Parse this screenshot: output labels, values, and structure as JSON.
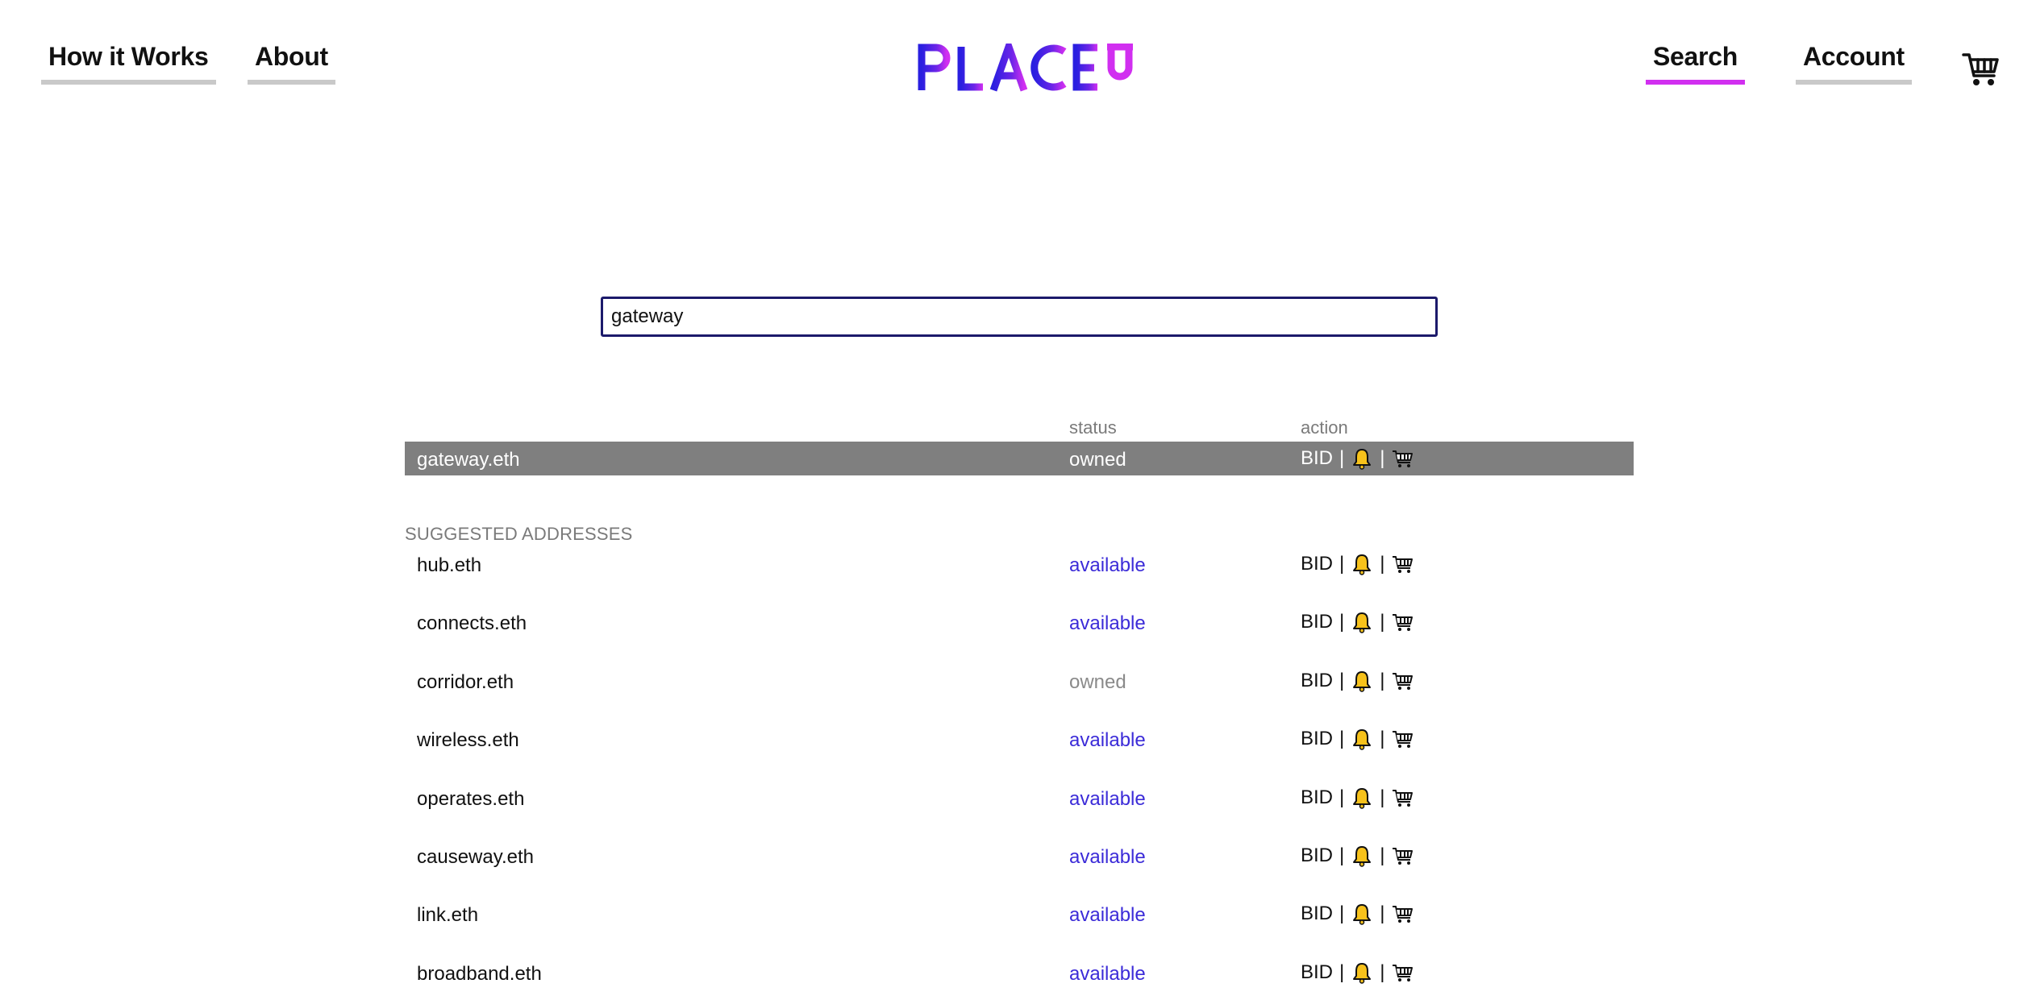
{
  "nav": {
    "how_it_works": "How it Works",
    "about": "About",
    "search": "Search",
    "account": "Account"
  },
  "brand": {
    "logo_text": "PLACEU",
    "colors": {
      "primary": "#2a1fe0",
      "accent": "#d12ff0"
    }
  },
  "search": {
    "value": "gateway"
  },
  "results": {
    "column_status": "status",
    "column_action": "action",
    "main": {
      "name": "gateway.eth",
      "status": "owned",
      "bid": "BID",
      "sep": "|"
    }
  },
  "suggested": {
    "label": "SUGGESTED ADDRESSES",
    "items": [
      {
        "name": "hub.eth",
        "status": "available",
        "bid": "BID",
        "sep": "|"
      },
      {
        "name": "connects.eth",
        "status": "available",
        "bid": "BID",
        "sep": "|"
      },
      {
        "name": "corridor.eth",
        "status": "owned",
        "bid": "BID",
        "sep": "|"
      },
      {
        "name": "wireless.eth",
        "status": "available",
        "bid": "BID",
        "sep": "|"
      },
      {
        "name": "operates.eth",
        "status": "available",
        "bid": "BID",
        "sep": "|"
      },
      {
        "name": "causeway.eth",
        "status": "available",
        "bid": "BID",
        "sep": "|"
      },
      {
        "name": "link.eth",
        "status": "available",
        "bid": "BID",
        "sep": "|"
      },
      {
        "name": "broadband.eth",
        "status": "available",
        "bid": "BID",
        "sep": "|"
      }
    ]
  },
  "icons": {
    "bell": "bell-icon",
    "cart": "cart-icon"
  }
}
